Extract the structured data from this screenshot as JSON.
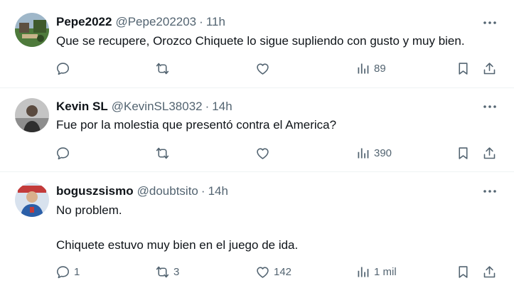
{
  "tweets": [
    {
      "name": "Pepe2022",
      "handle": "@Pepe202203",
      "separator": "·",
      "time": "11h",
      "text_lines": [
        "Que se recupere, Orozco Chiquete lo sigue supliendo con gusto y muy bien."
      ],
      "replies": "",
      "retweets": "",
      "likes": "",
      "views": "89"
    },
    {
      "name": "Kevin SL",
      "handle": "@KevinSL38032",
      "separator": "·",
      "time": "14h",
      "text_lines": [
        "Fue por la molestia que presentó contra el America?"
      ],
      "replies": "",
      "retweets": "",
      "likes": "",
      "views": "390"
    },
    {
      "name": "boguszsismo",
      "handle": "@doubtsito",
      "separator": "·",
      "time": "14h",
      "text_lines": [
        "No problem.",
        "",
        "Chiquete estuvo muy bien en el juego de ida."
      ],
      "replies": "1",
      "retweets": "3",
      "likes": "142",
      "views": "1 mil"
    }
  ],
  "icons": {
    "more": "more-dots-icon",
    "reply": "reply-icon",
    "retweet": "retweet-icon",
    "like": "heart-icon",
    "views": "views-chart-icon",
    "bookmark": "bookmark-icon",
    "share": "share-icon"
  },
  "colors": {
    "text": "#0f1419",
    "secondary": "#536471",
    "divider": "#eff3f4"
  }
}
